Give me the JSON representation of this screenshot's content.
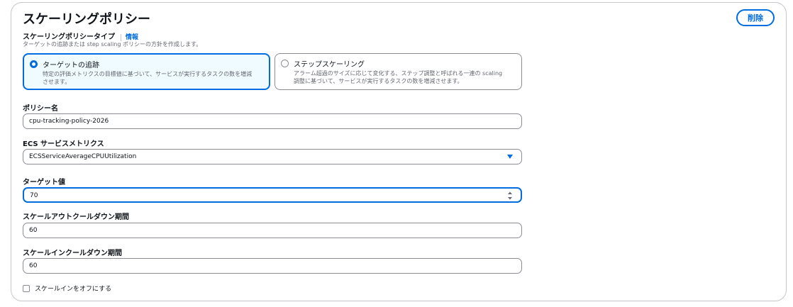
{
  "panel": {
    "title": "スケーリングポリシー",
    "delete_label": "削除"
  },
  "policy_type": {
    "label": "スケーリングポリシータイプ",
    "info_link": "情報",
    "description": "ターゲットの追跡または step scaling ポリシーの方針を作成します。",
    "options": [
      {
        "title": "ターゲットの追跡",
        "desc_line1": "特定の評価メトリクスの目標値に基づいて、サービスが実行するタスクの数を増減",
        "desc_line2": "させます。",
        "selected": true
      },
      {
        "title": "ステップスケーリング",
        "desc_line1": "アラーム超過のサイズに応じて変化する、ステップ調整と呼ばれる一連の scaling",
        "desc_line2": "調整に基づいて、サービスが実行するタスクの数を増減させます。",
        "selected": false
      }
    ]
  },
  "policy_name": {
    "label": "ポリシー名",
    "value": "cpu-tracking-policy-2026"
  },
  "metric": {
    "label": "ECS サービスメトリクス",
    "value": "ECSServiceAverageCPUUtilization"
  },
  "target_value": {
    "label": "ターゲット値",
    "value": "70"
  },
  "scale_out_cooldown": {
    "label": "スケールアウトクールダウン期間",
    "value": "60"
  },
  "scale_in_cooldown": {
    "label": "スケールインクールダウン期間",
    "value": "60"
  },
  "disable_scale_in": {
    "label": "スケールインをオフにする",
    "checked": false
  },
  "colors": {
    "accent": "#006ce0",
    "selected_bg": "#f0fbff",
    "border": "#8c8c94"
  }
}
